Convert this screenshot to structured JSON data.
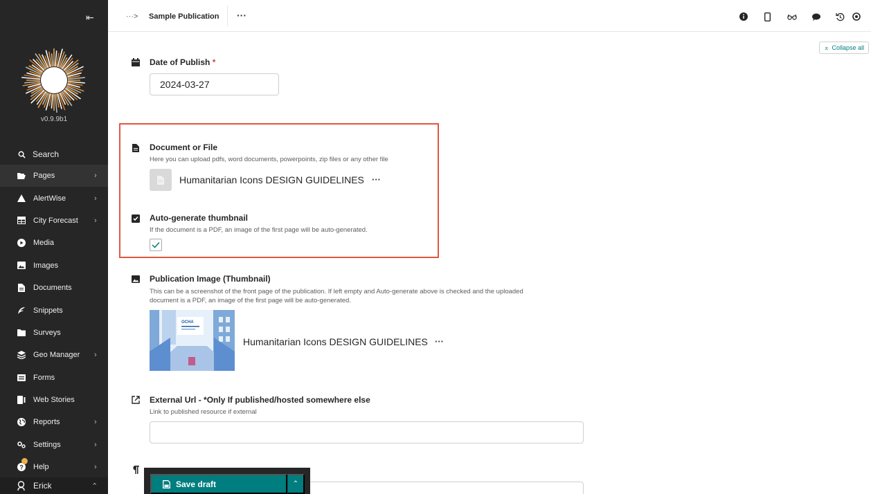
{
  "sidebar": {
    "version": "v0.9.9b1",
    "search_label": "Search",
    "items": [
      {
        "label": "Pages",
        "icon": "folder-open-icon",
        "chevron": true
      },
      {
        "label": "AlertWise",
        "icon": "warning-icon",
        "chevron": true
      },
      {
        "label": "City Forecast",
        "icon": "table-icon",
        "chevron": true
      },
      {
        "label": "Media",
        "icon": "play-icon",
        "chevron": false
      },
      {
        "label": "Images",
        "icon": "image-icon",
        "chevron": false
      },
      {
        "label": "Documents",
        "icon": "document-icon",
        "chevron": false
      },
      {
        "label": "Snippets",
        "icon": "snippet-icon",
        "chevron": false
      },
      {
        "label": "Surveys",
        "icon": "folder-icon",
        "chevron": false
      },
      {
        "label": "Geo Manager",
        "icon": "layers-icon",
        "chevron": true
      },
      {
        "label": "Forms",
        "icon": "form-icon",
        "chevron": false
      },
      {
        "label": "Web Stories",
        "icon": "stories-icon",
        "chevron": false
      },
      {
        "label": "Reports",
        "icon": "globe-icon",
        "chevron": true
      },
      {
        "label": "Settings",
        "icon": "cogs-icon",
        "chevron": true
      },
      {
        "label": "Help",
        "icon": "help-icon",
        "chevron": true
      }
    ],
    "user_name": "Erick"
  },
  "header": {
    "breadcrumb_arrow": "···>",
    "page_title": "Sample Publication",
    "more": "···",
    "collapse_all": "Collapse all"
  },
  "fields": {
    "date": {
      "label": "Date of Publish",
      "required": "*",
      "value": "2024-03-27"
    },
    "document": {
      "label": "Document or File",
      "help": "Here you can upload pdfs, word documents, powerpoints, zip files or any other file",
      "chosen_title": "Humanitarian Icons DESIGN GUIDELINES",
      "more": "···"
    },
    "autogen": {
      "label": "Auto-generate thumbnail",
      "help": "If the document is a PDF, an image of the first page will be auto-generated.",
      "checked": true
    },
    "pub_image": {
      "label": "Publication Image (Thumbnail)",
      "help_line1": "This can be a screenshot of the front page of the publication. If left empty and Auto-generate above is checked and the uploaded",
      "help_line2": "document is a PDF, an image of the first page will be auto-generated.",
      "chosen_title": "Humanitarian Icons DESIGN GUIDELINES",
      "more": "···",
      "thumb_text": "OCHA"
    },
    "external_url": {
      "label": "External Url - *Only If published/hosted somewhere else",
      "help": "Link to published resource if external",
      "value": ""
    }
  },
  "savebar": {
    "save_label": "Save draft"
  },
  "colors": {
    "accent": "#007d7e",
    "highlight": "#e0573d",
    "sidebar": "#262626"
  }
}
